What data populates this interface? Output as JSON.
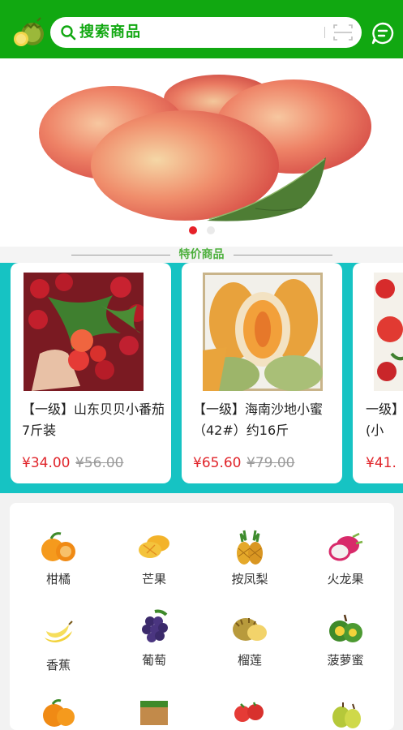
{
  "header": {
    "search_placeholder": "搜索商品",
    "logo_icon": "durian-logo-icon",
    "scan_icon": "scan-icon",
    "message_icon": "message-icon",
    "color": "#11a811"
  },
  "banner": {
    "image": "peach-banner",
    "active_dot": 0,
    "dot_count": 2
  },
  "special": {
    "title": "特价商品",
    "band_color": "#16c3c3",
    "products": [
      {
        "name": "【一级】山东贝贝小番茄7斤装",
        "price": "¥34.00",
        "old_price": "¥56.00"
      },
      {
        "name": "【一级】海南沙地小蜜（42#）约16斤",
        "price": "¥65.60",
        "old_price": "¥79.00"
      },
      {
        "name": "一级】(小",
        "price": "¥41.",
        "old_price": ""
      }
    ]
  },
  "categories": [
    {
      "label": "柑橘",
      "icon": "orange-icon"
    },
    {
      "label": "芒果",
      "icon": "mango-icon"
    },
    {
      "label": "按凤梨",
      "icon": "pineapple-icon"
    },
    {
      "label": "火龙果",
      "icon": "dragonfruit-icon"
    },
    {
      "label": "香蕉",
      "icon": "banana-icon"
    },
    {
      "label": "葡萄",
      "icon": "grape-icon"
    },
    {
      "label": "榴莲",
      "icon": "durian-icon"
    },
    {
      "label": "菠萝蜜",
      "icon": "jackfruit-icon"
    }
  ]
}
